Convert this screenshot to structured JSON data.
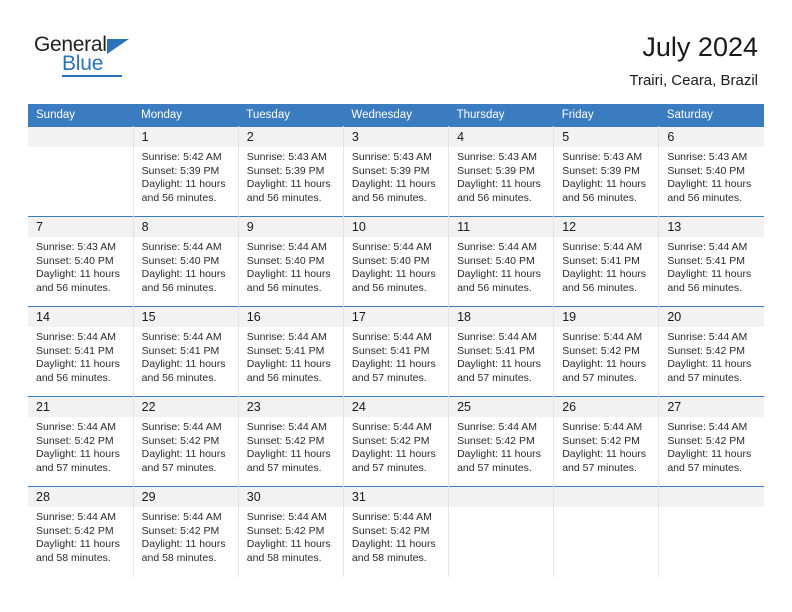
{
  "brand": {
    "name_part1": "General",
    "name_part2": "Blue",
    "accent_color": "#2b72b8"
  },
  "header": {
    "title": "July 2024",
    "subtitle": "Trairi, Ceara, Brazil",
    "header_bg": "#3b7cc0"
  },
  "weekday_headers": [
    "Sunday",
    "Monday",
    "Tuesday",
    "Wednesday",
    "Thursday",
    "Friday",
    "Saturday"
  ],
  "weeks": [
    [
      {
        "day": "",
        "blank": true,
        "sunrise": "",
        "sunset": "",
        "daylight_l1": "",
        "daylight_l2": ""
      },
      {
        "day": "1",
        "sunrise": "Sunrise: 5:42 AM",
        "sunset": "Sunset: 5:39 PM",
        "daylight_l1": "Daylight: 11 hours",
        "daylight_l2": "and 56 minutes."
      },
      {
        "day": "2",
        "sunrise": "Sunrise: 5:43 AM",
        "sunset": "Sunset: 5:39 PM",
        "daylight_l1": "Daylight: 11 hours",
        "daylight_l2": "and 56 minutes."
      },
      {
        "day": "3",
        "sunrise": "Sunrise: 5:43 AM",
        "sunset": "Sunset: 5:39 PM",
        "daylight_l1": "Daylight: 11 hours",
        "daylight_l2": "and 56 minutes."
      },
      {
        "day": "4",
        "sunrise": "Sunrise: 5:43 AM",
        "sunset": "Sunset: 5:39 PM",
        "daylight_l1": "Daylight: 11 hours",
        "daylight_l2": "and 56 minutes."
      },
      {
        "day": "5",
        "sunrise": "Sunrise: 5:43 AM",
        "sunset": "Sunset: 5:39 PM",
        "daylight_l1": "Daylight: 11 hours",
        "daylight_l2": "and 56 minutes."
      },
      {
        "day": "6",
        "sunrise": "Sunrise: 5:43 AM",
        "sunset": "Sunset: 5:40 PM",
        "daylight_l1": "Daylight: 11 hours",
        "daylight_l2": "and 56 minutes."
      }
    ],
    [
      {
        "day": "7",
        "sunrise": "Sunrise: 5:43 AM",
        "sunset": "Sunset: 5:40 PM",
        "daylight_l1": "Daylight: 11 hours",
        "daylight_l2": "and 56 minutes."
      },
      {
        "day": "8",
        "sunrise": "Sunrise: 5:44 AM",
        "sunset": "Sunset: 5:40 PM",
        "daylight_l1": "Daylight: 11 hours",
        "daylight_l2": "and 56 minutes."
      },
      {
        "day": "9",
        "sunrise": "Sunrise: 5:44 AM",
        "sunset": "Sunset: 5:40 PM",
        "daylight_l1": "Daylight: 11 hours",
        "daylight_l2": "and 56 minutes."
      },
      {
        "day": "10",
        "sunrise": "Sunrise: 5:44 AM",
        "sunset": "Sunset: 5:40 PM",
        "daylight_l1": "Daylight: 11 hours",
        "daylight_l2": "and 56 minutes."
      },
      {
        "day": "11",
        "sunrise": "Sunrise: 5:44 AM",
        "sunset": "Sunset: 5:40 PM",
        "daylight_l1": "Daylight: 11 hours",
        "daylight_l2": "and 56 minutes."
      },
      {
        "day": "12",
        "sunrise": "Sunrise: 5:44 AM",
        "sunset": "Sunset: 5:41 PM",
        "daylight_l1": "Daylight: 11 hours",
        "daylight_l2": "and 56 minutes."
      },
      {
        "day": "13",
        "sunrise": "Sunrise: 5:44 AM",
        "sunset": "Sunset: 5:41 PM",
        "daylight_l1": "Daylight: 11 hours",
        "daylight_l2": "and 56 minutes."
      }
    ],
    [
      {
        "day": "14",
        "sunrise": "Sunrise: 5:44 AM",
        "sunset": "Sunset: 5:41 PM",
        "daylight_l1": "Daylight: 11 hours",
        "daylight_l2": "and 56 minutes."
      },
      {
        "day": "15",
        "sunrise": "Sunrise: 5:44 AM",
        "sunset": "Sunset: 5:41 PM",
        "daylight_l1": "Daylight: 11 hours",
        "daylight_l2": "and 56 minutes."
      },
      {
        "day": "16",
        "sunrise": "Sunrise: 5:44 AM",
        "sunset": "Sunset: 5:41 PM",
        "daylight_l1": "Daylight: 11 hours",
        "daylight_l2": "and 56 minutes."
      },
      {
        "day": "17",
        "sunrise": "Sunrise: 5:44 AM",
        "sunset": "Sunset: 5:41 PM",
        "daylight_l1": "Daylight: 11 hours",
        "daylight_l2": "and 57 minutes."
      },
      {
        "day": "18",
        "sunrise": "Sunrise: 5:44 AM",
        "sunset": "Sunset: 5:41 PM",
        "daylight_l1": "Daylight: 11 hours",
        "daylight_l2": "and 57 minutes."
      },
      {
        "day": "19",
        "sunrise": "Sunrise: 5:44 AM",
        "sunset": "Sunset: 5:42 PM",
        "daylight_l1": "Daylight: 11 hours",
        "daylight_l2": "and 57 minutes."
      },
      {
        "day": "20",
        "sunrise": "Sunrise: 5:44 AM",
        "sunset": "Sunset: 5:42 PM",
        "daylight_l1": "Daylight: 11 hours",
        "daylight_l2": "and 57 minutes."
      }
    ],
    [
      {
        "day": "21",
        "sunrise": "Sunrise: 5:44 AM",
        "sunset": "Sunset: 5:42 PM",
        "daylight_l1": "Daylight: 11 hours",
        "daylight_l2": "and 57 minutes."
      },
      {
        "day": "22",
        "sunrise": "Sunrise: 5:44 AM",
        "sunset": "Sunset: 5:42 PM",
        "daylight_l1": "Daylight: 11 hours",
        "daylight_l2": "and 57 minutes."
      },
      {
        "day": "23",
        "sunrise": "Sunrise: 5:44 AM",
        "sunset": "Sunset: 5:42 PM",
        "daylight_l1": "Daylight: 11 hours",
        "daylight_l2": "and 57 minutes."
      },
      {
        "day": "24",
        "sunrise": "Sunrise: 5:44 AM",
        "sunset": "Sunset: 5:42 PM",
        "daylight_l1": "Daylight: 11 hours",
        "daylight_l2": "and 57 minutes."
      },
      {
        "day": "25",
        "sunrise": "Sunrise: 5:44 AM",
        "sunset": "Sunset: 5:42 PM",
        "daylight_l1": "Daylight: 11 hours",
        "daylight_l2": "and 57 minutes."
      },
      {
        "day": "26",
        "sunrise": "Sunrise: 5:44 AM",
        "sunset": "Sunset: 5:42 PM",
        "daylight_l1": "Daylight: 11 hours",
        "daylight_l2": "and 57 minutes."
      },
      {
        "day": "27",
        "sunrise": "Sunrise: 5:44 AM",
        "sunset": "Sunset: 5:42 PM",
        "daylight_l1": "Daylight: 11 hours",
        "daylight_l2": "and 57 minutes."
      }
    ],
    [
      {
        "day": "28",
        "sunrise": "Sunrise: 5:44 AM",
        "sunset": "Sunset: 5:42 PM",
        "daylight_l1": "Daylight: 11 hours",
        "daylight_l2": "and 58 minutes."
      },
      {
        "day": "29",
        "sunrise": "Sunrise: 5:44 AM",
        "sunset": "Sunset: 5:42 PM",
        "daylight_l1": "Daylight: 11 hours",
        "daylight_l2": "and 58 minutes."
      },
      {
        "day": "30",
        "sunrise": "Sunrise: 5:44 AM",
        "sunset": "Sunset: 5:42 PM",
        "daylight_l1": "Daylight: 11 hours",
        "daylight_l2": "and 58 minutes."
      },
      {
        "day": "31",
        "sunrise": "Sunrise: 5:44 AM",
        "sunset": "Sunset: 5:42 PM",
        "daylight_l1": "Daylight: 11 hours",
        "daylight_l2": "and 58 minutes."
      },
      {
        "day": "",
        "blank": true,
        "sunrise": "",
        "sunset": "",
        "daylight_l1": "",
        "daylight_l2": ""
      },
      {
        "day": "",
        "blank": true,
        "sunrise": "",
        "sunset": "",
        "daylight_l1": "",
        "daylight_l2": ""
      },
      {
        "day": "",
        "blank": true,
        "sunrise": "",
        "sunset": "",
        "daylight_l1": "",
        "daylight_l2": ""
      }
    ]
  ]
}
